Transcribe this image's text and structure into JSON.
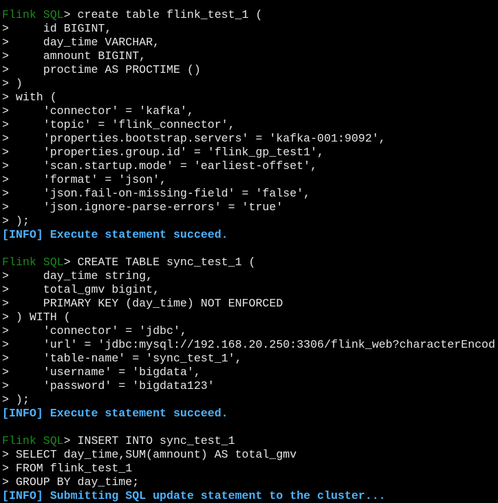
{
  "terminal": {
    "prompt": "Flink SQL",
    "colors": {
      "background": "#000000",
      "text": "#e6e6e6",
      "prompt": "#1a8a1a",
      "info": "#4db3ff"
    },
    "lines": [
      {
        "type": "prompt",
        "text": "> create table flink_test_1 ("
      },
      {
        "type": "cont",
        "text": ">     id BIGINT,"
      },
      {
        "type": "cont",
        "text": ">     day_time VARCHAR,"
      },
      {
        "type": "cont",
        "text": ">     amnount BIGINT,"
      },
      {
        "type": "cont",
        "text": ">     proctime AS PROCTIME ()"
      },
      {
        "type": "cont",
        "text": "> )"
      },
      {
        "type": "cont",
        "text": "> with ("
      },
      {
        "type": "cont",
        "text": ">     'connector' = 'kafka',"
      },
      {
        "type": "cont",
        "text": ">     'topic' = 'flink_connector',"
      },
      {
        "type": "cont",
        "text": ">     'properties.bootstrap.servers' = 'kafka-001:9092',"
      },
      {
        "type": "cont",
        "text": ">     'properties.group.id' = 'flink_gp_test1',"
      },
      {
        "type": "cont",
        "text": ">     'scan.startup.mode' = 'earliest-offset',"
      },
      {
        "type": "cont",
        "text": ">     'format' = 'json',"
      },
      {
        "type": "cont",
        "text": ">     'json.fail-on-missing-field' = 'false',"
      },
      {
        "type": "cont",
        "text": ">     'json.ignore-parse-errors' = 'true'"
      },
      {
        "type": "cont",
        "text": "> );"
      },
      {
        "type": "info",
        "text": "[INFO] Execute statement succeed."
      },
      {
        "type": "blank",
        "text": ""
      },
      {
        "type": "prompt",
        "text": "> CREATE TABLE sync_test_1 ("
      },
      {
        "type": "cont",
        "text": ">     day_time string,"
      },
      {
        "type": "cont",
        "text": ">     total_gmv bigint,"
      },
      {
        "type": "cont",
        "text": ">     PRIMARY KEY (day_time) NOT ENFORCED"
      },
      {
        "type": "cont",
        "text": "> ) WITH ("
      },
      {
        "type": "cont",
        "text": ">     'connector' = 'jdbc',"
      },
      {
        "type": "cont",
        "text": ">     'url' = 'jdbc:mysql://192.168.20.250:3306/flink_web?characterEncod"
      },
      {
        "type": "cont",
        "text": ">     'table-name' = 'sync_test_1',"
      },
      {
        "type": "cont",
        "text": ">     'username' = 'bigdata',"
      },
      {
        "type": "cont",
        "text": ">     'password' = 'bigdata123'"
      },
      {
        "type": "cont",
        "text": "> );"
      },
      {
        "type": "info",
        "text": "[INFO] Execute statement succeed."
      },
      {
        "type": "blank",
        "text": ""
      },
      {
        "type": "prompt",
        "text": "> INSERT INTO sync_test_1"
      },
      {
        "type": "cont",
        "text": "> SELECT day_time,SUM(amnount) AS total_gmv"
      },
      {
        "type": "cont",
        "text": "> FROM flink_test_1"
      },
      {
        "type": "cont",
        "text": "> GROUP BY day_time;"
      },
      {
        "type": "info",
        "text": "[INFO] Submitting SQL update statement to the cluster..."
      }
    ]
  }
}
